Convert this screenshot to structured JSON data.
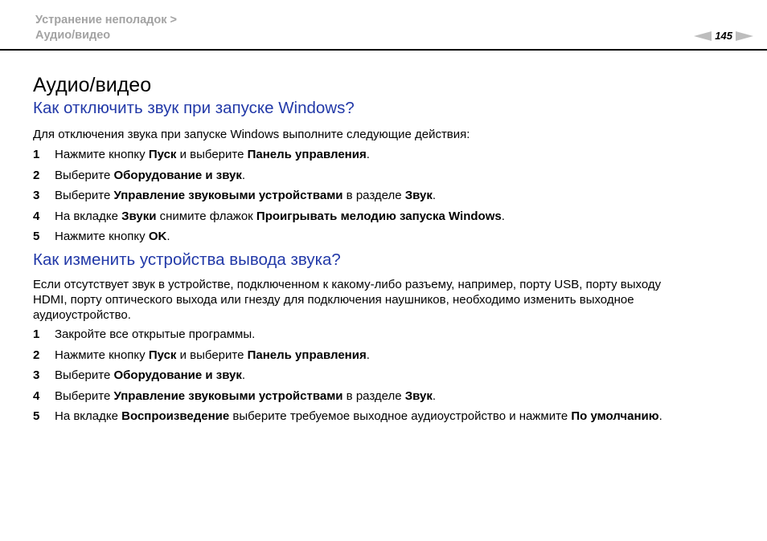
{
  "header": {
    "breadcrumb": [
      "Устранение неполадок >",
      "Аудио/видео"
    ],
    "page_number": "145"
  },
  "page_title": "Аудио/видео",
  "section1": {
    "title": "Как отключить звук при запуске Windows?",
    "intro": "Для отключения звука при запуске Windows выполните следующие действия:",
    "steps": [
      {
        "num": "1",
        "parts": [
          "Нажмите кнопку ",
          "Пуск",
          " и выберите ",
          "Панель управления",
          "."
        ]
      },
      {
        "num": "2",
        "parts": [
          "Выберите ",
          "Оборудование и звук",
          "."
        ]
      },
      {
        "num": "3",
        "parts": [
          "Выберите ",
          "Управление звуковыми устройствами",
          " в разделе ",
          "Звук",
          "."
        ]
      },
      {
        "num": "4",
        "parts": [
          "На вкладке ",
          "Звуки",
          " снимите флажок ",
          "Проигрывать мелодию запуска Windows",
          "."
        ]
      },
      {
        "num": "5",
        "parts": [
          "Нажмите кнопку ",
          "OK",
          "."
        ]
      }
    ]
  },
  "section2": {
    "title": "Как изменить устройства вывода звука?",
    "intro_lines": [
      "Если отсутствует звук в устройстве, подключенном к какому-либо разъему, например, порту USB, порту выходу",
      "HDMI, порту оптического выхода или гнезду для подключения наушников, необходимо изменить выходное",
      "аудиоустройство."
    ],
    "steps": [
      {
        "num": "1",
        "parts": [
          "Закройте все открытые программы."
        ]
      },
      {
        "num": "2",
        "parts": [
          "Нажмите кнопку ",
          "Пуск",
          " и выберите ",
          "Панель управления",
          "."
        ]
      },
      {
        "num": "3",
        "parts": [
          "Выберите ",
          "Оборудование и звук",
          "."
        ]
      },
      {
        "num": "4",
        "parts": [
          "Выберите ",
          "Управление звуковыми устройствами",
          " в разделе ",
          "Звук",
          "."
        ]
      },
      {
        "num": "5",
        "parts": [
          "На вкладке ",
          "Воспроизведение",
          " выберите требуемое выходное аудиоустройство и нажмите ",
          "По умолчанию",
          "."
        ]
      }
    ]
  },
  "colors": {
    "heading_blue": "#2239a8",
    "breadcrumb_gray": "#a3a3a3",
    "arrow_gray": "#bdbdbd"
  }
}
